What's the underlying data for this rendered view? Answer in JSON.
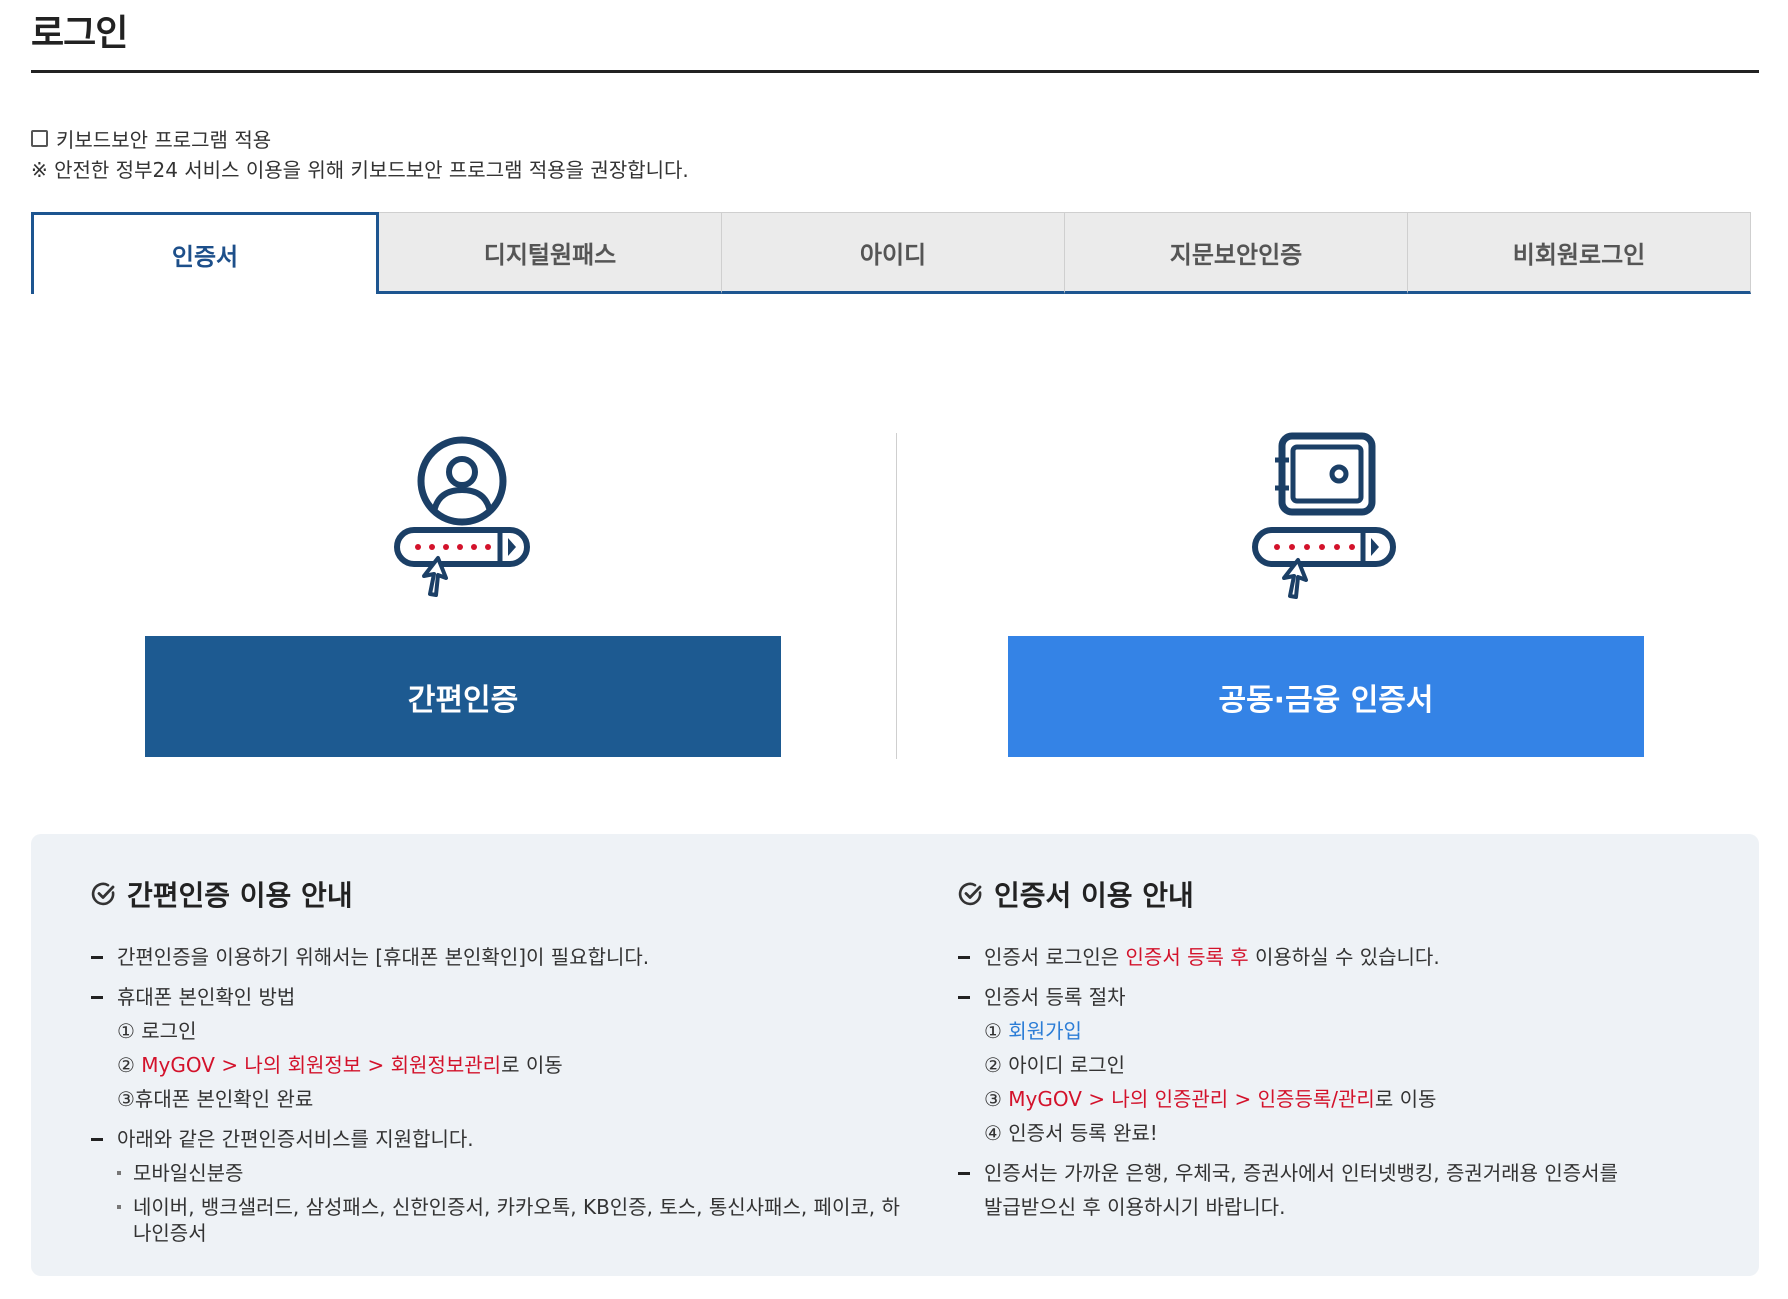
{
  "page": {
    "title": "로그인"
  },
  "keyboard_security": {
    "checkbox_label": "키보드보안 프로그램 적용",
    "checked": false,
    "note": "※ 안전한 정부24 서비스 이용을 위해 키보드보안 프로그램 적용을 권장합니다."
  },
  "tabs": [
    {
      "label": "인증서",
      "active": true
    },
    {
      "label": "디지털원패스",
      "active": false
    },
    {
      "label": "아이디",
      "active": false
    },
    {
      "label": "지문보안인증",
      "active": false
    },
    {
      "label": "비회원로그인",
      "active": false
    }
  ],
  "auth_options": {
    "simple": {
      "button_label": "간편인증",
      "icon": "user-password-icon"
    },
    "cert": {
      "button_label": "공동·금융 인증서",
      "icon": "safe-password-icon"
    }
  },
  "colors": {
    "primary_dark": "#1d5a91",
    "primary_light": "#3483e6",
    "highlight_red": "#d3122b",
    "link_blue": "#2c7dd6",
    "panel_bg": "#eef2f6"
  },
  "guide_simple": {
    "heading": "간편인증 이용 안내",
    "item1": "간편인증을 이용하기 위해서는 [휴대폰 본인확인]이 필요합니다.",
    "item2": "휴대폰 본인확인 방법",
    "step1": "① 로그인",
    "step2_prefix": "② ",
    "step2_red1": "MyGOV > 나의 회원정보 > 회원정보관리",
    "step2_suffix": "로 이동",
    "step3": "③휴대폰 본인확인 완료",
    "item3": "아래와 같은 간편인증서비스를 지원합니다.",
    "bullet1": "모바일신분증",
    "bullet2": "네이버, 뱅크샐러드, 삼성패스, 신한인증서, 카카오톡, KB인증, 토스, 통신사패스, 페이코, 하나인증서"
  },
  "guide_cert": {
    "heading": "인증서 이용 안내",
    "item1_prefix": "인증서 로그인은 ",
    "item1_red": "인증서 등록 후",
    "item1_suffix": " 이용하실 수 있습니다.",
    "item2": "인증서 등록 절차",
    "step1_prefix": "① ",
    "step1_link": "회원가입",
    "step2": "② 아이디 로그인",
    "step3_prefix": "③ ",
    "step3_red": "MyGOV > 나의 인증관리 > 인증등록/관리",
    "step3_suffix": "로 이동",
    "step4": "④ 인증서 등록 완료!",
    "item3_line1": "인증서는 가까운 은행, 우체국, 증권사에서 인터넷뱅킹, 증권거래용 인증서를",
    "item3_line2": "발급받으신 후 이용하시기 바랍니다."
  }
}
